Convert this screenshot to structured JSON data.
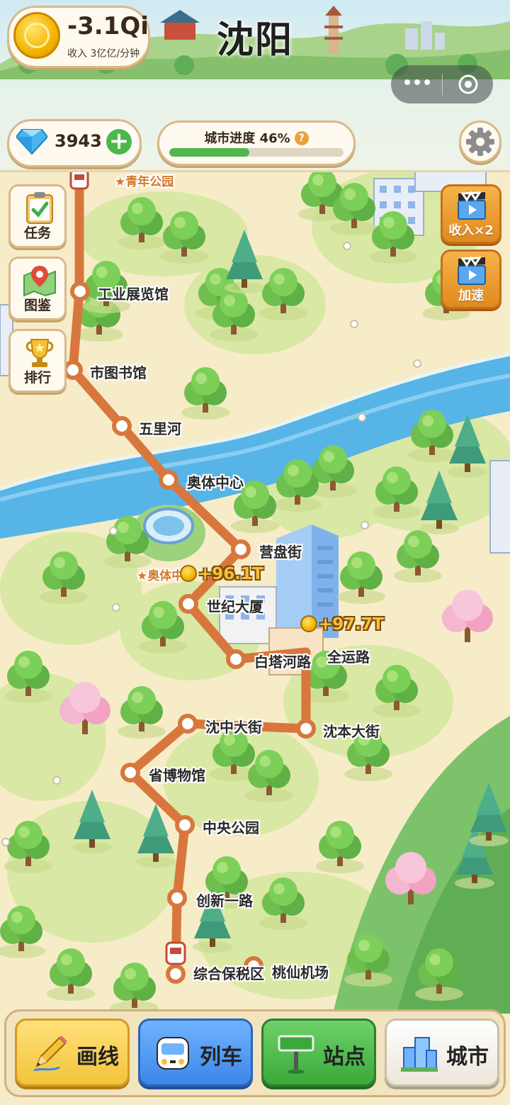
{
  "header": {
    "coins_value": "-3.1Qi",
    "coins_rate": "收入 3亿亿/分钟",
    "city_name": "沈阳",
    "gems": "3943",
    "progress_label": "城市进度 46%",
    "progress_help": "?",
    "progress_fraction": 0.46
  },
  "system_capsule": {
    "more": "•••"
  },
  "side_menu": [
    {
      "label": "任务",
      "icon": "clipboard-check-icon"
    },
    {
      "label": "图鉴",
      "icon": "map-pin-icon"
    },
    {
      "label": "排行",
      "icon": "trophy-icon"
    }
  ],
  "boost_buttons": [
    {
      "label": "收入×2",
      "icon": "clapperboard-icon"
    },
    {
      "label": "加速",
      "icon": "clapperboard-icon"
    }
  ],
  "stations": [
    {
      "name": "★青年公园",
      "landmark": true
    },
    {
      "name": "工业展览馆"
    },
    {
      "name": "市图书馆"
    },
    {
      "name": "五里河"
    },
    {
      "name": "奥体中心"
    },
    {
      "name": "营盘街"
    },
    {
      "name": "★奥体中",
      "landmark": true
    },
    {
      "name": "世纪大厦"
    },
    {
      "name": "白塔河路"
    },
    {
      "name": "全运路"
    },
    {
      "name": "沈本大街"
    },
    {
      "name": "沈中大街"
    },
    {
      "name": "省博物馆"
    },
    {
      "name": "中央公园"
    },
    {
      "name": "创新一路"
    },
    {
      "name": "综合保税区"
    },
    {
      "name": "桃仙机场"
    }
  ],
  "income_popups": [
    "+96.1T",
    "+97.7T"
  ],
  "tabs": [
    {
      "label": "画线",
      "icon": "pencil-icon"
    },
    {
      "label": "列车",
      "icon": "train-icon"
    },
    {
      "label": "站点",
      "icon": "signpost-icon"
    },
    {
      "label": "城市",
      "icon": "buildings-icon"
    }
  ],
  "colors": {
    "route": "#d8773d",
    "river": "#56b4e6",
    "ground": "#f6ecc9",
    "coin": "#f3b400",
    "accent_green": "#4cb84a"
  }
}
